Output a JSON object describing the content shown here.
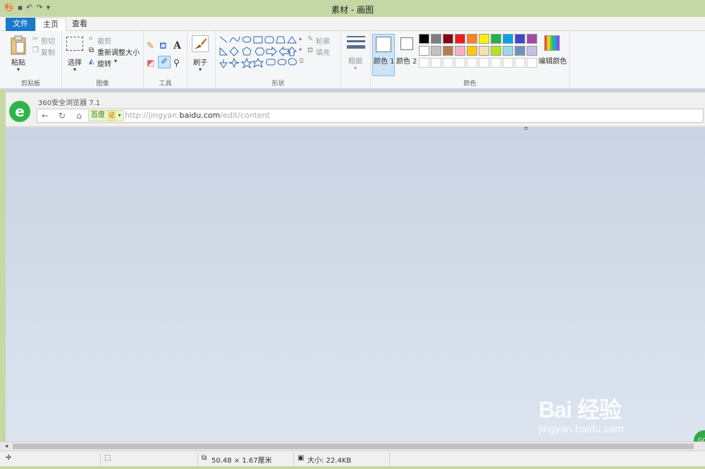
{
  "window": {
    "title": "素材 - 画图"
  },
  "tabs": {
    "file": "文件",
    "home": "主页",
    "view": "查看"
  },
  "clipboard": {
    "paste": "粘贴",
    "cut": "剪切",
    "copy": "复制",
    "group": "剪贴板"
  },
  "image": {
    "select": "选择",
    "crop": "裁剪",
    "resize": "重新调整大小",
    "rotate": "旋转",
    "group": "图像"
  },
  "tools": {
    "group": "工具"
  },
  "brushes": {
    "label": "刷子"
  },
  "shapes": {
    "outline": "轮廓",
    "fill": "填充",
    "group": "形状"
  },
  "size": {
    "label": "粗细"
  },
  "colors": {
    "color1": "颜色 1",
    "color2": "颜色 2",
    "edit": "编辑颜色",
    "group": "颜色",
    "row1": [
      "#000000",
      "#7f7f7f",
      "#880015",
      "#ed1c24",
      "#ff7f27",
      "#fff200",
      "#22b14c",
      "#00a2e8",
      "#3f48cc",
      "#a349a4"
    ],
    "row2": [
      "#ffffff",
      "#c3c3c3",
      "#b97a57",
      "#ffaec9",
      "#ffc90e",
      "#efe4b0",
      "#b5e61d",
      "#99d9ea",
      "#7092be",
      "#c8bfe7"
    ]
  },
  "browser": {
    "title": "360安全浏览器 7.1",
    "baidu": "百度",
    "cert": "证",
    "url_prefix": "http://jingyan.",
    "url_domain": "baidu.com",
    "url_path": "/edit/content"
  },
  "status": {
    "dimensions": "50.48 × 1.67厘米",
    "size": "大小: 22.4KB"
  },
  "watermark": {
    "brand": "Bai 经验",
    "url": "jingyan.baidu.com",
    "go": "GO"
  }
}
